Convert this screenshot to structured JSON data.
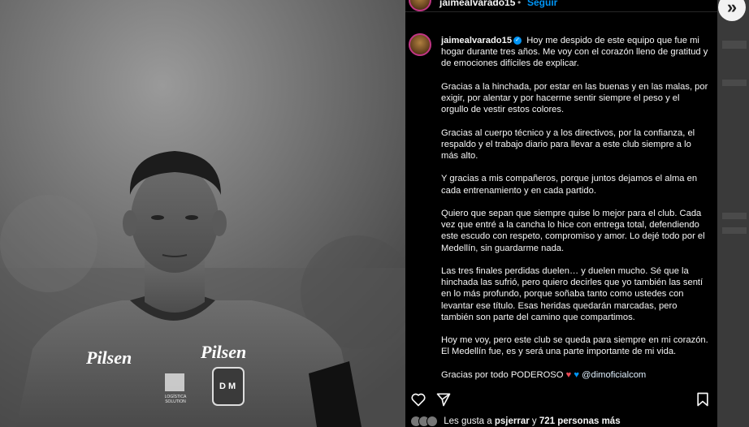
{
  "header": {
    "username": "jaimealvarado15",
    "dot": "•",
    "follow_label": "Seguir"
  },
  "photo": {
    "sponsor_left": "Pilsen",
    "sponsor_right": "Pilsen",
    "crest_text": "D M",
    "sleeve_text": "LOGÍSTICA SOLUTION"
  },
  "caption": {
    "username": "jaimealvarado15",
    "verified_glyph": "✓",
    "intro": "Hoy me despido de este equipo que fue mi hogar durante tres años. Me voy con el corazón lleno de gratitud y de emociones difíciles de explicar.",
    "p1": "Gracias a la hinchada, por estar en las buenas y en las malas, por exigir, por alentar y por hacerme sentir siempre el peso y el orgullo de vestir estos colores.",
    "p2": "Gracias al cuerpo técnico y a los directivos, por la confianza, el respaldo y el trabajo diario para llevar a este club siempre a lo más alto.",
    "p3": "Y gracias a mis compañeros, porque juntos dejamos el alma en cada entrenamiento y en cada partido.",
    "p4": "Quiero que sepan que siempre quise lo mejor para el club. Cada vez que entré a la cancha lo hice con entrega total, defendiendo este escudo con respeto, compromiso y amor. Lo dejé todo por el Medellín, sin guardarme nada.",
    "p5": "Las tres finales perdidas duelen… y duelen mucho. Sé que la hinchada las sufrió, pero quiero decirles que yo también las sentí en lo más profundo, porque soñaba tanto como ustedes con levantar ese título. Esas heridas quedarán marcadas, pero también son parte del camino que compartimos.",
    "p6": "Hoy me voy, pero este club se queda para siempre en mi corazón. El Medellín fue, es y será una parte importante de mi vida.",
    "closing": "Gracias por todo PODEROSO",
    "heart_red": "♥",
    "heart_blue": "♥",
    "mention": "@dimoficialcom"
  },
  "likes": {
    "prefix": "Les gusta a",
    "user": "psjerrar",
    "middle": "y",
    "count": "721 personas más"
  },
  "nav": {
    "next_glyph": "»"
  },
  "colors": {
    "verified": "#0095f6",
    "follow": "#0095f6",
    "heart_red": "#ed4956",
    "heart_blue": "#0095f6"
  }
}
